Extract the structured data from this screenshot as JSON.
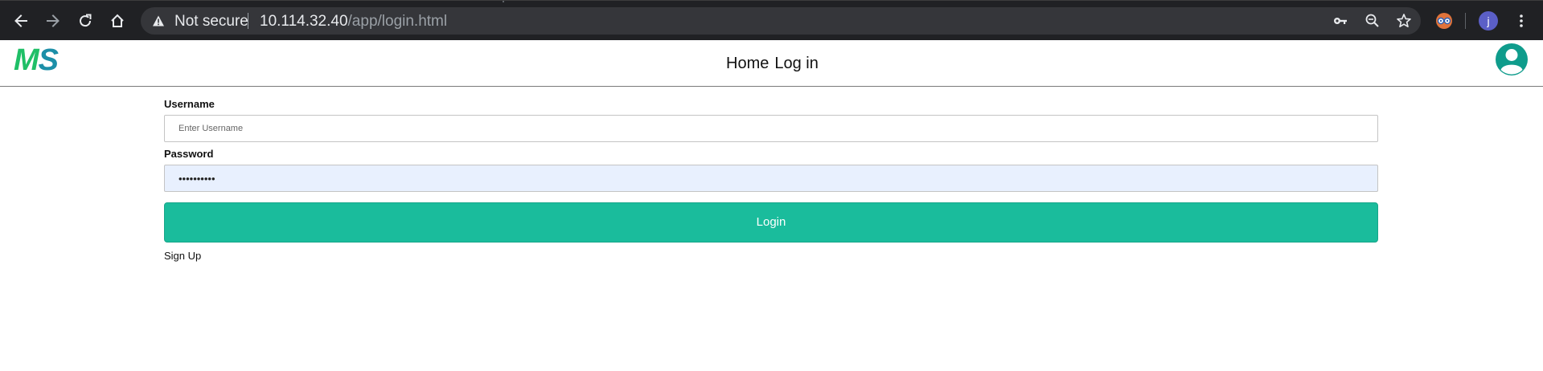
{
  "browser": {
    "security_status": "Not secure",
    "url_host": "10.114.32.40",
    "url_path": "/app/login.html",
    "profile_initial": "j",
    "icons": [
      "back-icon",
      "forward-icon",
      "reload-icon",
      "home-icon",
      "warning-icon",
      "key-icon",
      "zoom-out-icon",
      "star-icon",
      "extension-icon",
      "menu-icon"
    ]
  },
  "navbar": {
    "logo_m": "M",
    "logo_s": "S",
    "links": [
      {
        "label": "Home"
      },
      {
        "label": "Log in"
      }
    ],
    "avatar_icon": "user-avatar-icon"
  },
  "form": {
    "username_label": "Username",
    "username_placeholder": "Enter Username",
    "username_value": "",
    "password_label": "Password",
    "password_value": "••••••••••",
    "login_label": "Login",
    "signup_label": "Sign Up"
  },
  "colors": {
    "accent": "#1abc9c",
    "logo_m": "#1fbf67",
    "logo_s": "#1c8fa8",
    "avatar": "#0f9c8c",
    "chrome_bg": "#202124",
    "autofill_bg": "#e8f0fe"
  }
}
